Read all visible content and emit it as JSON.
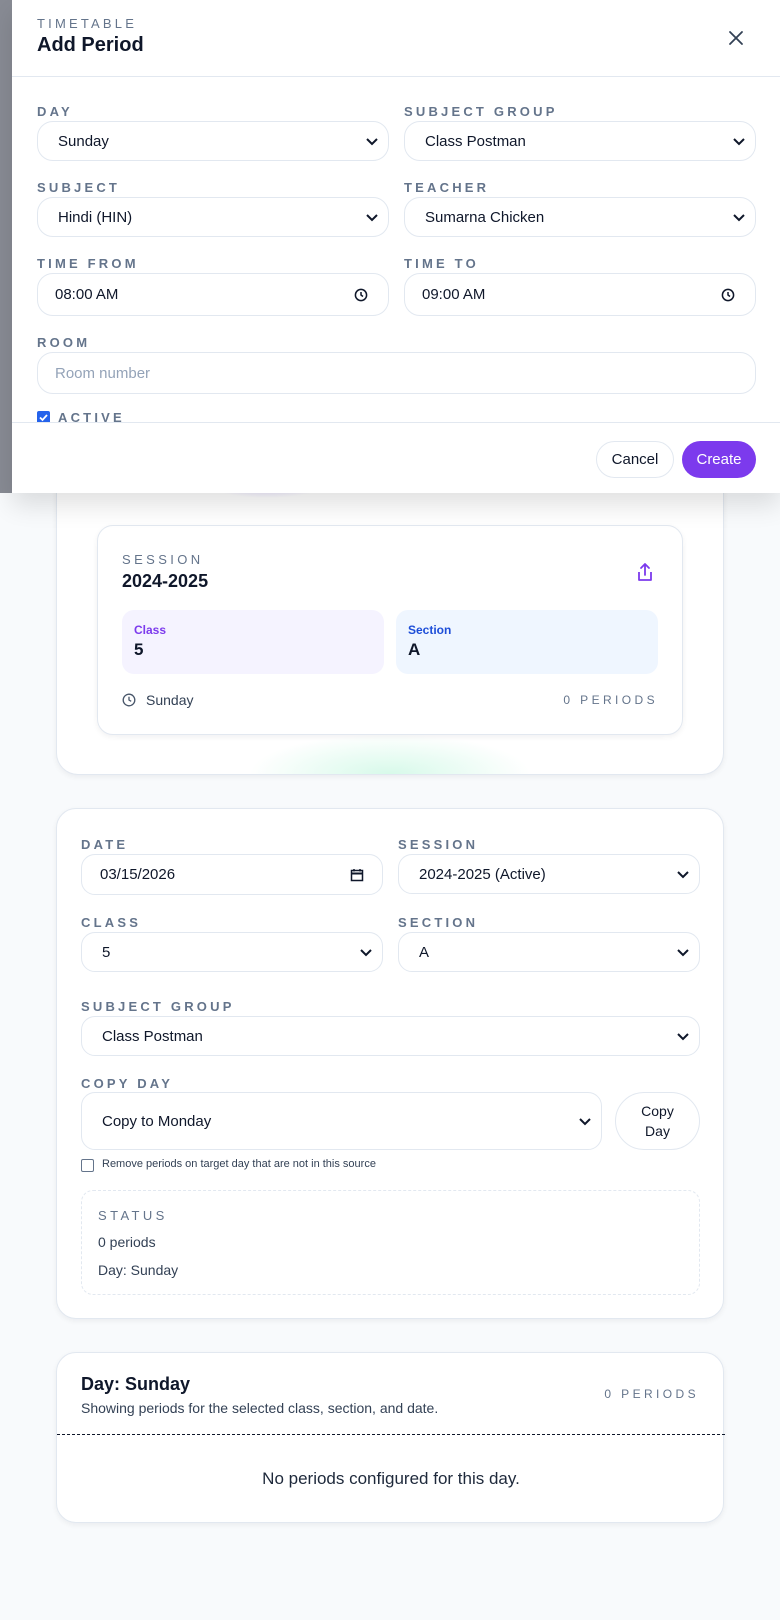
{
  "modal": {
    "kicker": "TIMETABLE",
    "title": "Add Period",
    "day_label": "DAY",
    "day_value": "Sunday",
    "subject_group_label": "SUBJECT GROUP",
    "subject_group_value": "Class Postman",
    "subject_label": "SUBJECT",
    "subject_value": "Hindi (HIN)",
    "teacher_label": "TEACHER",
    "teacher_value": "Sumarna Chicken",
    "time_from_label": "TIME FROM",
    "time_from_value": "08:00 AM",
    "time_to_label": "TIME TO",
    "time_to_value": "09:00 AM",
    "room_label": "ROOM",
    "room_placeholder": "Room number",
    "active_label": "ACTIVE",
    "cancel_label": "Cancel",
    "create_label": "Create"
  },
  "session_card": {
    "kicker": "SESSION",
    "value": "2024-2025",
    "class_label": "Class",
    "class_value": "5",
    "section_label": "Section",
    "section_value": "A",
    "day": "Sunday",
    "periods": "0 PERIODS"
  },
  "filters": {
    "date_label": "DATE",
    "date_value": "03/15/2026",
    "session_label": "SESSION",
    "session_value": "2024-2025 (Active)",
    "class_label": "CLASS",
    "class_value": "5",
    "section_label": "SECTION",
    "section_value": "A",
    "subject_group_label": "SUBJECT GROUP",
    "subject_group_value": "Class Postman",
    "copy_day_label": "COPY DAY",
    "copy_day_value": "Copy to Monday",
    "copy_button_line1": "Copy",
    "copy_button_line2": "Day",
    "remove_checkbox_label": "Remove periods on target day that are not in this source",
    "status_label": "STATUS",
    "status_periods": "0 periods",
    "status_day": "Day: Sunday"
  },
  "day_panel": {
    "title": "Day: Sunday",
    "subtitle": "Showing periods for the selected class, section, and date.",
    "periods": "0 PERIODS",
    "empty_text": "No periods configured for this day."
  },
  "colors": {
    "accent": "#7c3aed",
    "class_tile_bg": "#f5f3ff",
    "section_tile_bg": "#eff6ff",
    "section_text": "#1d4ed8"
  },
  "icons": [
    "close-icon",
    "chevron-down-icon",
    "clock-icon",
    "calendar-icon",
    "share-icon",
    "checkbox-checked-icon"
  ]
}
